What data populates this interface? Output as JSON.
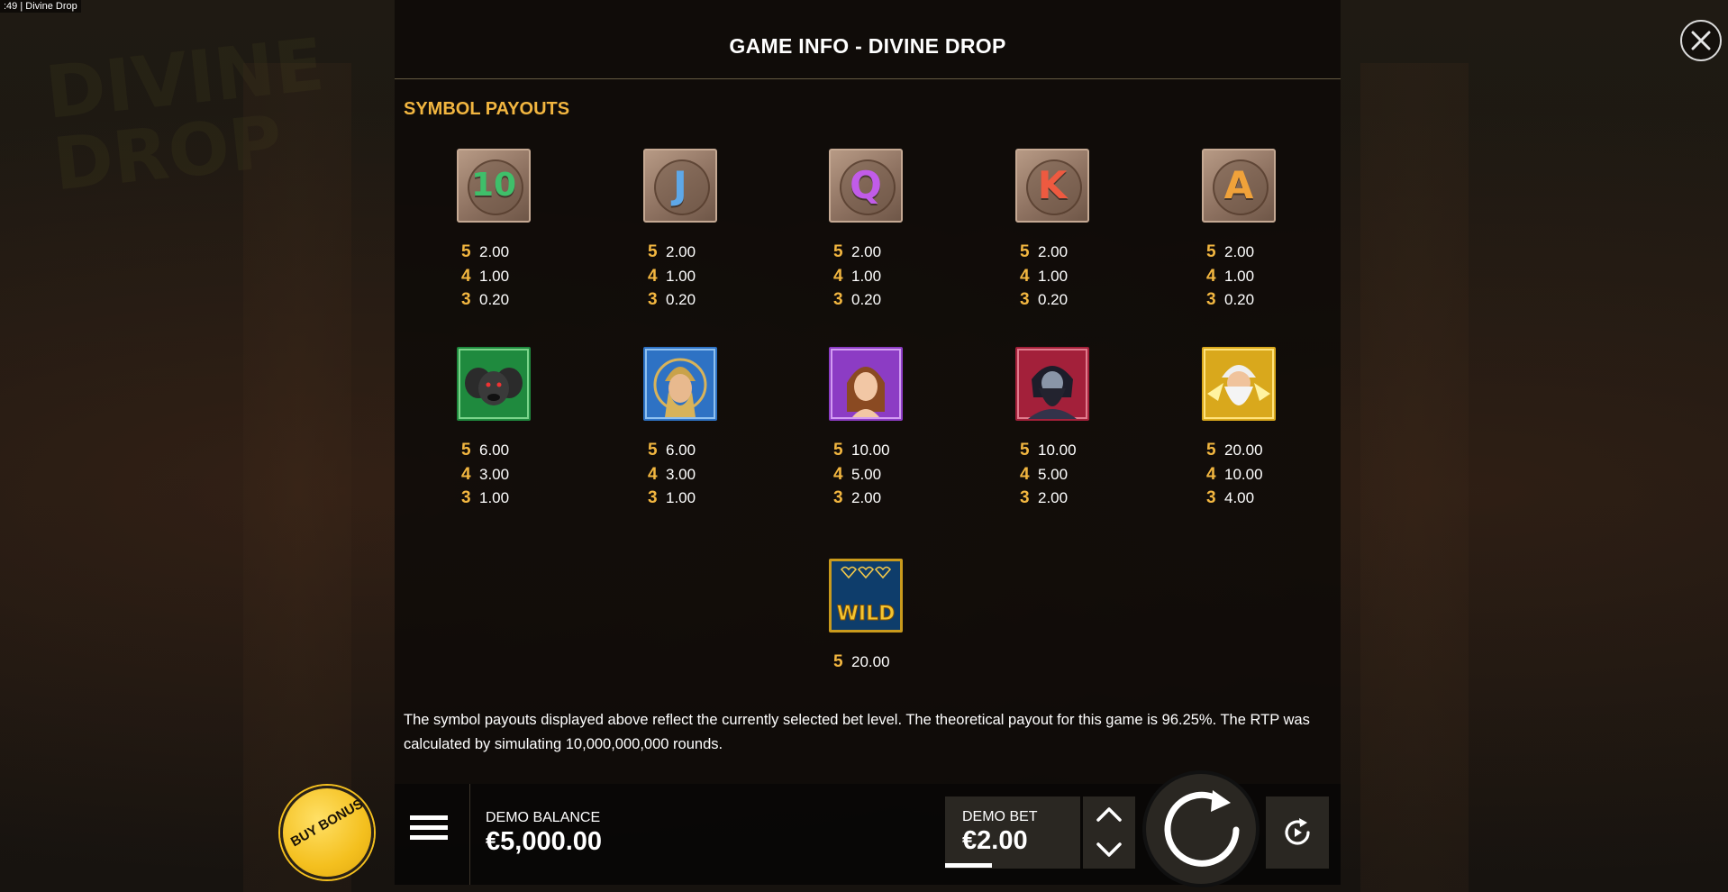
{
  "window": {
    "title": ":49  |  Divine Drop"
  },
  "panel": {
    "title": "GAME INFO - DIVINE DROP",
    "section_title": "SYMBOL PAYOUTS",
    "footnote": "The symbol payouts displayed above reflect the currently selected bet level. The theoretical payout for this game is 96.25%. The RTP was calculated by simulating 10,000,000,000 rounds."
  },
  "colors": {
    "accent_gold": "#f2b640",
    "panel_bg": "#0e0b08",
    "buy_bonus": "#f4c01f"
  },
  "symbols": {
    "row1": [
      {
        "glyph": "10",
        "color": "#3fbf6a",
        "icon": "ten-card-icon",
        "pays": [
          [
            "5",
            "2.00"
          ],
          [
            "4",
            "1.00"
          ],
          [
            "3",
            "0.20"
          ]
        ]
      },
      {
        "glyph": "J",
        "color": "#5ea8e8",
        "icon": "jack-card-icon",
        "pays": [
          [
            "5",
            "2.00"
          ],
          [
            "4",
            "1.00"
          ],
          [
            "3",
            "0.20"
          ]
        ]
      },
      {
        "glyph": "Q",
        "color": "#c15ce8",
        "icon": "queen-card-icon",
        "pays": [
          [
            "5",
            "2.00"
          ],
          [
            "4",
            "1.00"
          ],
          [
            "3",
            "0.20"
          ]
        ]
      },
      {
        "glyph": "K",
        "color": "#ee5a40",
        "icon": "king-card-icon",
        "pays": [
          [
            "5",
            "2.00"
          ],
          [
            "4",
            "1.00"
          ],
          [
            "3",
            "0.20"
          ]
        ]
      },
      {
        "glyph": "A",
        "color": "#f0a23a",
        "icon": "ace-card-icon",
        "pays": [
          [
            "5",
            "2.00"
          ],
          [
            "4",
            "1.00"
          ],
          [
            "3",
            "0.20"
          ]
        ]
      }
    ],
    "row2": [
      {
        "icon": "cerberus-icon",
        "bg": "#1f8a3e",
        "pays": [
          [
            "5",
            "6.00"
          ],
          [
            "4",
            "3.00"
          ],
          [
            "3",
            "1.00"
          ]
        ]
      },
      {
        "icon": "athena-icon",
        "bg": "#2e72c4",
        "pays": [
          [
            "5",
            "6.00"
          ],
          [
            "4",
            "3.00"
          ],
          [
            "3",
            "1.00"
          ]
        ]
      },
      {
        "icon": "aphrodite-icon",
        "bg": "#8c3cc4",
        "pays": [
          [
            "5",
            "10.00"
          ],
          [
            "4",
            "5.00"
          ],
          [
            "3",
            "2.00"
          ]
        ]
      },
      {
        "icon": "hades-icon",
        "bg": "#a3203a",
        "pays": [
          [
            "5",
            "10.00"
          ],
          [
            "4",
            "5.00"
          ],
          [
            "3",
            "2.00"
          ]
        ]
      },
      {
        "icon": "zeus-icon",
        "bg": "#d9a81c",
        "pays": [
          [
            "5",
            "20.00"
          ],
          [
            "4",
            "10.00"
          ],
          [
            "3",
            "4.00"
          ]
        ]
      }
    ],
    "wild": {
      "icon": "wild-icon",
      "label": "WILD",
      "pays": [
        [
          "5",
          "20.00"
        ]
      ]
    }
  },
  "controls": {
    "buy_bonus_label": "BUY BONUS",
    "balance_label": "DEMO BALANCE",
    "balance_value": "€5,000.00",
    "bet_label": "DEMO BET",
    "bet_value": "€2.00"
  }
}
